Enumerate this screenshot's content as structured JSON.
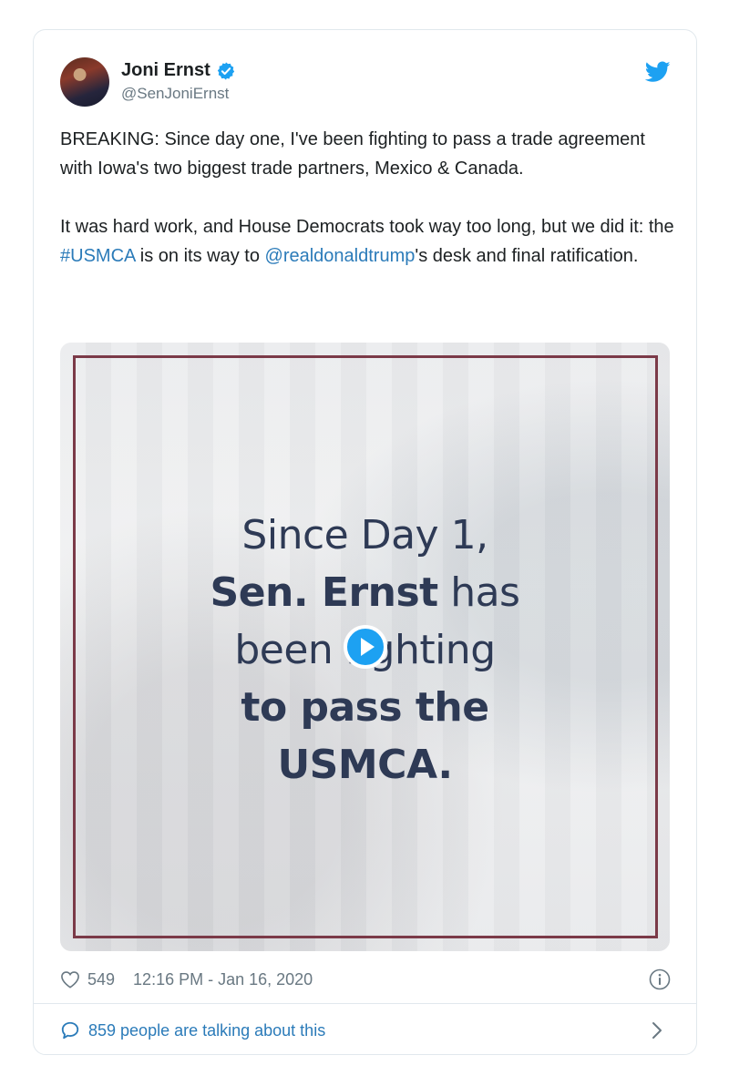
{
  "tweet": {
    "author_name": "Joni Ernst",
    "author_handle": "@SenJoniErnst",
    "para1": "BREAKING: Since day one, I've been fighting to pass a trade agreement with Iowa's two biggest trade partners, Mexico & Canada.",
    "para2_part1": "It was hard work, and House Democrats took way too long, but we did it: the ",
    "para2_hashtag": "#USMCA",
    "para2_part2": " is on its way to ",
    "para2_mention": "@realdonaldtrump",
    "para2_part3": "'s desk and final ratification."
  },
  "media": {
    "line1": "Since Day 1,",
    "line2_bold": "Sen. Ernst",
    "line2_rest": " has",
    "line3": "been fighting",
    "line4": "to pass the",
    "line5": "USMCA."
  },
  "meta": {
    "likes": "549",
    "timestamp": "12:16 PM - Jan 16, 2020"
  },
  "footer": {
    "talking": "859 people are talking about this"
  },
  "icons": {
    "verified": "verified-badge-icon",
    "bird": "twitter-bird-icon",
    "heart": "heart-icon",
    "info": "info-icon",
    "bubble": "speech-bubble-icon",
    "chevron": "chevron-right-icon",
    "play": "play-icon"
  },
  "colors": {
    "link": "#2b7bb9",
    "brand": "#1da1f2",
    "frame": "#7b3a48",
    "overlay_text": "#2e3a55"
  }
}
